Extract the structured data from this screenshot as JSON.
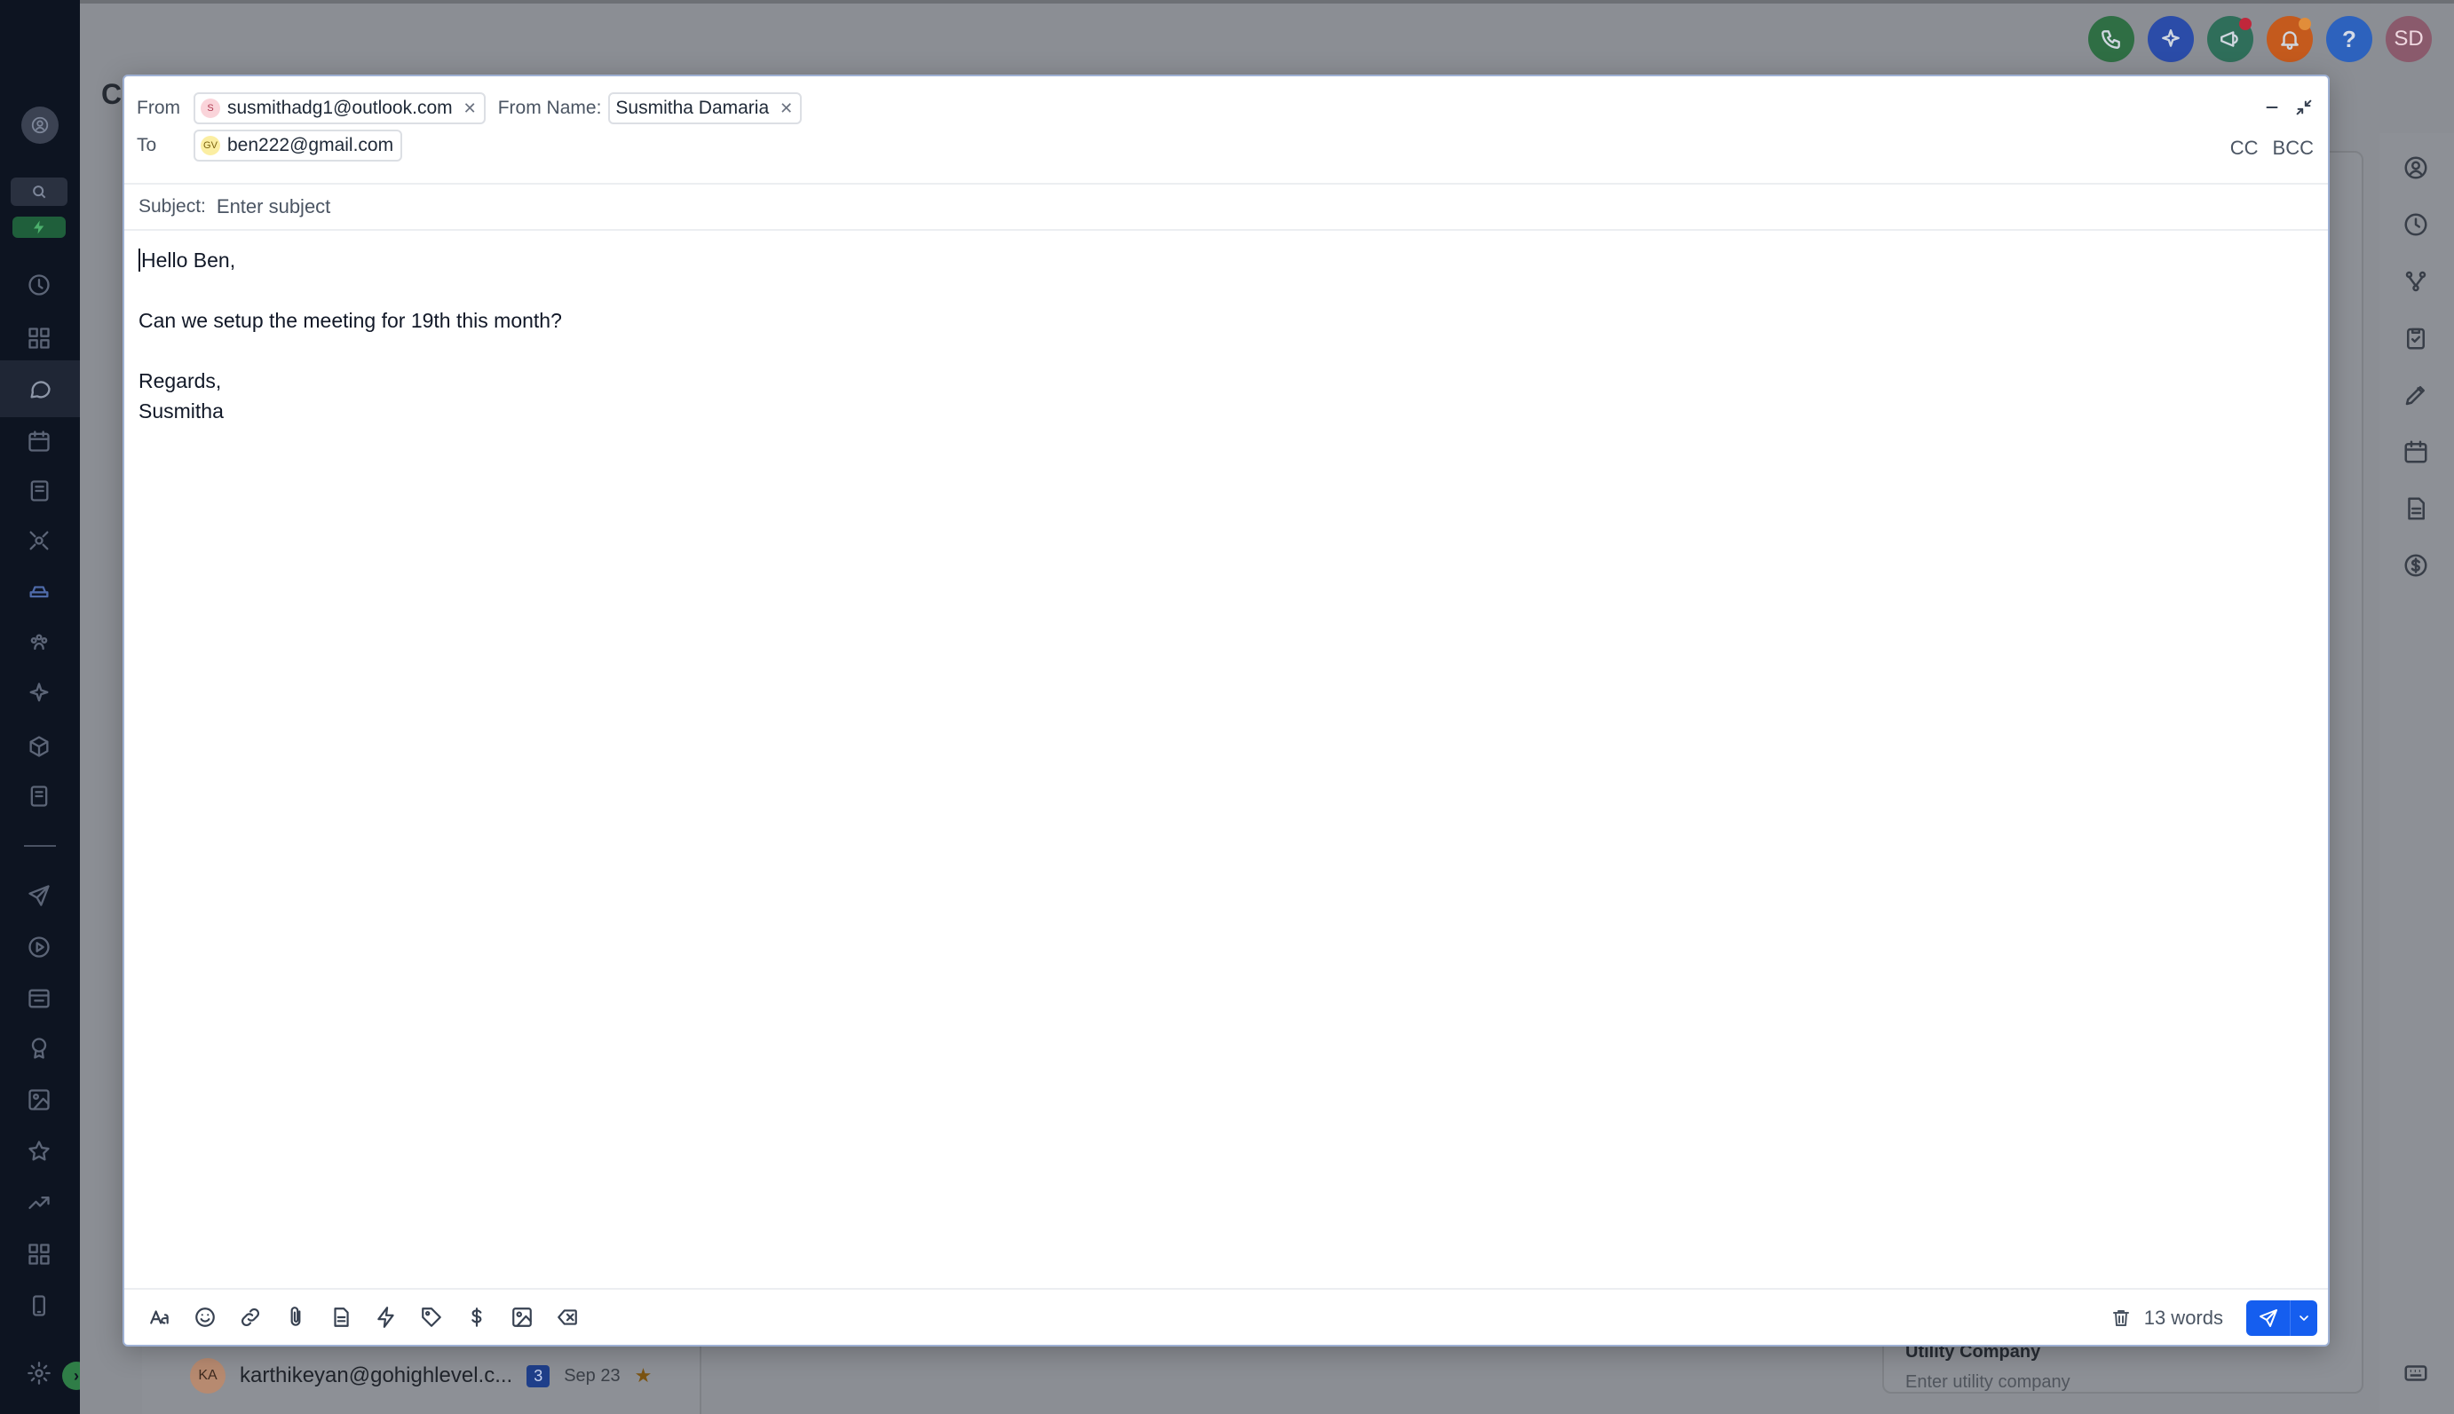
{
  "background": {
    "page_heading_fragment": "Co",
    "contact_row": {
      "avatar_initials": "KA",
      "email": "karthikeyan@gohighlevel.c...",
      "badge_count": "3",
      "date": "Sep 23"
    },
    "right_panel_field": {
      "label": "Utility Company",
      "placeholder": "Enter utility company"
    },
    "topbar": {
      "help_label": "?",
      "user_initials": "SD"
    },
    "colors": {
      "phone": "#2f6e44",
      "ai": "#2b4ca8",
      "announce": "#2f6e5a",
      "notify": "#c45a1d",
      "help": "#2d62bd",
      "user": "#8a5a6c"
    }
  },
  "compose": {
    "from_label": "From",
    "from_email": "susmithadg1@outlook.com",
    "from_avatar_initials": "S",
    "from_name_label": "From Name:",
    "from_name_value": "Susmitha Damaria",
    "to_label": "To",
    "to_email": "ben222@gmail.com",
    "to_avatar_initials": "GV",
    "cc_label": "CC",
    "bcc_label": "BCC",
    "subject_label": "Subject:",
    "subject_placeholder": "Enter subject",
    "subject_value": "",
    "body_lines": [
      "Hello Ben,",
      "",
      "Can we setup the meeting for 19th this month?",
      "",
      "Regards,",
      "Susmitha"
    ],
    "word_count": "13 words",
    "accent_color": "#155eef"
  }
}
